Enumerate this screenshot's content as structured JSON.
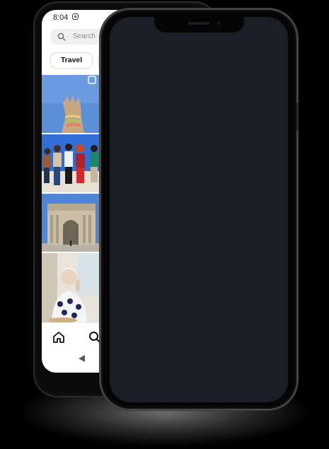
{
  "status_bar": {
    "time": "8:04"
  },
  "search": {
    "placeholder": "Search"
  },
  "chips": [
    {
      "label": "Travel"
    }
  ],
  "photos": [
    {
      "subject": "hand-sculpture"
    },
    {
      "subject": "group-sitting"
    },
    {
      "subject": "arch-monument"
    },
    {
      "subject": "woman-eating"
    }
  ],
  "icons": {
    "status": "instagram-icon",
    "search": "search-icon",
    "home": "home-icon",
    "nav_search": "search-nav-icon",
    "back": "back-icon"
  },
  "colors": {
    "background": "#000000",
    "iphone_screen": "#1a1f27",
    "android_screen": "#ffffff"
  }
}
